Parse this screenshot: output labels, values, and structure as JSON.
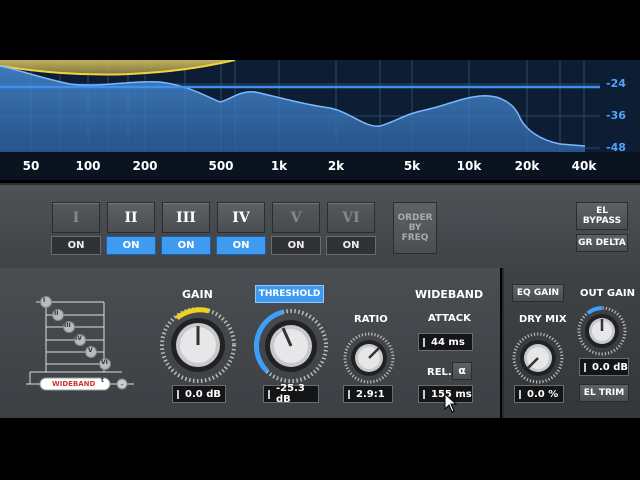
{
  "analyzer": {
    "freq_labels": [
      "50",
      "100",
      "200",
      "500",
      "1k",
      "2k",
      "5k",
      "10k",
      "20k",
      "40k"
    ],
    "db_labels": [
      "-24",
      "-36",
      "-48"
    ]
  },
  "bands": [
    {
      "label": "I",
      "on_label": "ON",
      "active": false
    },
    {
      "label": "II",
      "on_label": "ON",
      "active": true
    },
    {
      "label": "III",
      "on_label": "ON",
      "active": true
    },
    {
      "label": "IV",
      "on_label": "ON",
      "active": true
    },
    {
      "label": "V",
      "on_label": "ON",
      "active": false
    },
    {
      "label": "VI",
      "on_label": "ON",
      "active": false
    }
  ],
  "order_by_freq": "ORDER BY FREQ",
  "el_bypass": "EL BYPASS",
  "gr_delta": "GR DELTA",
  "routing": {
    "nodes": [
      "I",
      "II",
      "III",
      "IV",
      "V",
      "VI"
    ],
    "wideband_label": "WIDEBAND",
    "wideband_mark": "t"
  },
  "gain": {
    "label": "GAIN",
    "value": "0.0 dB"
  },
  "threshold": {
    "label": "THRESHOLD",
    "value": "-25.3 dB"
  },
  "ratio": {
    "label": "RATIO",
    "value": "2.9:1"
  },
  "wideband": {
    "label": "WIDEBAND",
    "attack_label": "ATTACK",
    "attack_value": "44 ms",
    "release_label": "REL.",
    "release_mode": "α",
    "release_value": "155 ms"
  },
  "eq_gain": "EQ GAIN",
  "dry_mix": {
    "label": "DRY MIX",
    "value": "0.0 %"
  },
  "out_gain": {
    "label": "OUT GAIN",
    "value": "0.0 dB"
  },
  "el_trim": "EL TRIM"
}
